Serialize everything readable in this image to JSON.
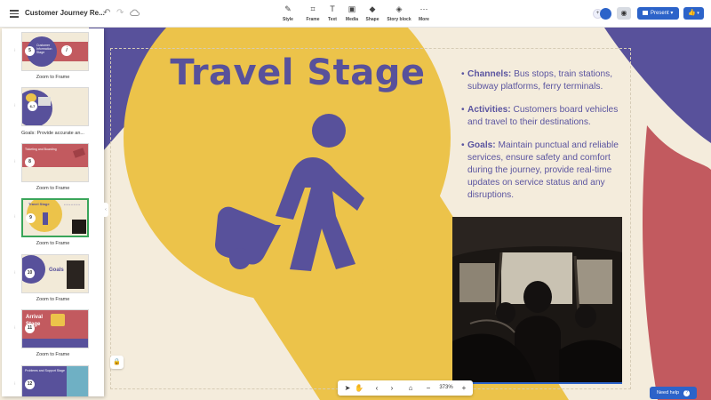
{
  "toolbar": {
    "title": "Customer Journey Re...",
    "tools": [
      {
        "label": "Style",
        "glyph": "✎"
      },
      {
        "label": "Frame",
        "glyph": "⌗"
      },
      {
        "label": "Text",
        "glyph": "T"
      },
      {
        "label": "Media",
        "glyph": "▣"
      },
      {
        "label": "Shape",
        "glyph": "◆"
      },
      {
        "label": "Story block",
        "glyph": "◈"
      },
      {
        "label": "More",
        "glyph": "⋯"
      }
    ],
    "present_label": "Present",
    "undo_glyph": "↶",
    "redo_glyph": "↷"
  },
  "slide": {
    "title": "Travel Stage",
    "bullets": [
      {
        "heading": "Channels:",
        "text": " Bus stops, train stations, subway platforms, ferry terminals."
      },
      {
        "heading": "Activities:",
        "text": " Customers board vehicles and travel to their destinations."
      },
      {
        "heading": "Goals:",
        "text": " Maintain punctual and reliable services, ensure safety and comfort during the journey, provide real-time updates on service status and any disruptions."
      }
    ]
  },
  "thumbnails": [
    {
      "num": "5",
      "caption": "Zoom to Frame",
      "thumb_text": "Customer Information Stage",
      "selected": false
    },
    {
      "num": "6-7",
      "caption": "Goals: Provide accurate an...",
      "thumb_text": "",
      "selected": false
    },
    {
      "num": "8",
      "caption": "Zoom to Frame",
      "thumb_text": "Ticketing and Boarding",
      "selected": false
    },
    {
      "num": "9",
      "caption": "Zoom to Frame",
      "thumb_text": "Travel Stage",
      "selected": true
    },
    {
      "num": "10",
      "caption": "Zoom to Frame",
      "thumb_text": "Goals",
      "selected": false
    },
    {
      "num": "11",
      "caption": "Zoom to Frame",
      "thumb_text": "Arrival Stage",
      "selected": false
    },
    {
      "num": "12",
      "caption": "",
      "thumb_text": "Problems and Support Stage",
      "selected": false
    }
  ],
  "bottom": {
    "zoom": "373%",
    "help_label": "Need help"
  },
  "colors": {
    "brand_blue": "#2c63c9",
    "purple": "#58519b",
    "yellow": "#ecc34a",
    "red": "#c25a5f",
    "cream": "#f4ecdc"
  }
}
